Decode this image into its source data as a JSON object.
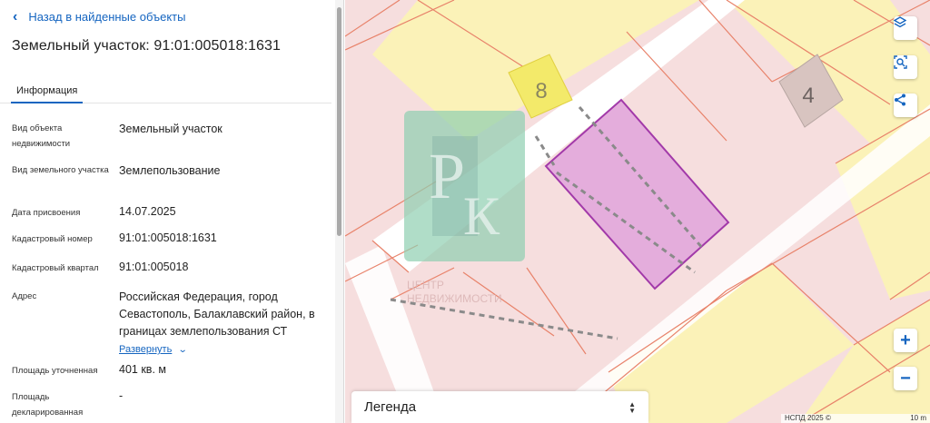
{
  "back_link": {
    "label": "Назад в найденные объекты"
  },
  "title": "Земельный участок: 91:01:005018:1631",
  "tabs": [
    {
      "label": "Информация"
    }
  ],
  "fields": [
    {
      "label": "Вид объекта недвижимости",
      "value": "Земельный участок"
    },
    {
      "label": "Вид земельного участка",
      "value": "Землепользование"
    },
    {
      "label": "Дата присвоения",
      "value": "14.07.2025"
    },
    {
      "label": "Кадастровый номер",
      "value": "91:01:005018:1631"
    },
    {
      "label": "Кадастровый квартал",
      "value": "91:01:005018"
    },
    {
      "label": "Адрес",
      "value": "Российская Федерация, город Севастополь, Балаклавский район, в границах землепользования СТ"
    },
    {
      "label": "Площадь уточненная",
      "value": "401 кв. м"
    },
    {
      "label": "Площадь декларированная",
      "value": "-"
    }
  ],
  "address_expand": {
    "label": "Развернуть"
  },
  "map": {
    "plot_labels": [
      "8",
      "4"
    ],
    "watermark": {
      "monogram_p": "Р",
      "monogram_k": "К",
      "text_line1": "ЦЕНТР",
      "text_line2": "НЕДВИЖИМОСТИ"
    },
    "controls": {
      "layers_icon": "layers-icon",
      "select_icon": "area-select-icon",
      "share_icon": "share-icon",
      "zoom_in": "+",
      "zoom_out": "−"
    },
    "legend": {
      "label": "Легенда"
    },
    "attribution": {
      "source": "НСПД 2025 ©",
      "scale": "10 m"
    },
    "colors": {
      "parcel_fill": "#f6dede",
      "parcel_border": "#e8826a",
      "yellow_zone": "#fbf2b8",
      "selected_fill": "#e3a9dc",
      "selected_border": "#9b2ca5",
      "road": "#ffffff",
      "accent": "#1565c0"
    }
  }
}
